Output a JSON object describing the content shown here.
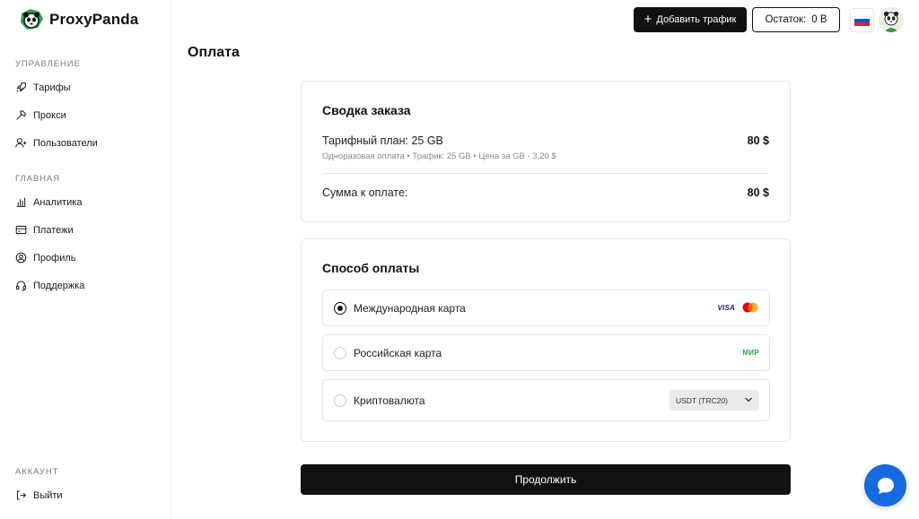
{
  "brand": {
    "name": "ProxyPanda"
  },
  "sidebar": {
    "sections": [
      {
        "title": "УПРАВЛЕНИЕ",
        "items": [
          {
            "label": "Тарифы",
            "icon": "rocket-icon"
          },
          {
            "label": "Прокси",
            "icon": "hammer-icon"
          },
          {
            "label": "Пользователи",
            "icon": "user-plus-icon"
          }
        ]
      },
      {
        "title": "ГЛАВНАЯ",
        "items": [
          {
            "label": "Аналитика",
            "icon": "bar-chart-icon"
          },
          {
            "label": "Платежи",
            "icon": "credit-card-icon"
          },
          {
            "label": "Профиль",
            "icon": "user-circle-icon"
          },
          {
            "label": "Поддержка",
            "icon": "headset-icon"
          }
        ]
      },
      {
        "title": "АККАУНТ",
        "items": [
          {
            "label": "Выйти",
            "icon": "logout-icon"
          }
        ]
      }
    ]
  },
  "header": {
    "add_traffic": "Добавить трафик",
    "balance_label": "Остаток:",
    "balance_value": "0 B",
    "language": "RU"
  },
  "page": {
    "title": "Оплата"
  },
  "summary": {
    "title": "Сводка заказа",
    "plan": "Тарифный план: 25 GB",
    "plan_price": "80 $",
    "details": "Одноразовая оплата • Трафик: 25 GB • Цена за GB - 3,20 $",
    "total_label": "Сумма к оплате:",
    "total_value": "80 $"
  },
  "payment": {
    "title": "Способ оплаты",
    "options": [
      {
        "label": "Международная карта",
        "selected": true,
        "badges": [
          "VISA",
          "mastercard-icon"
        ]
      },
      {
        "label": "Российская карта",
        "selected": false,
        "badges": [
          "МИР"
        ]
      },
      {
        "label": "Криптовалюта",
        "selected": false,
        "select_value": "USDT (TRC20)"
      }
    ]
  },
  "actions": {
    "continue": "Продолжить"
  },
  "colors": {
    "primary": "#111111",
    "chat": "#1769e0",
    "mir": "#2aa44d",
    "visa": "#1a1f71"
  }
}
